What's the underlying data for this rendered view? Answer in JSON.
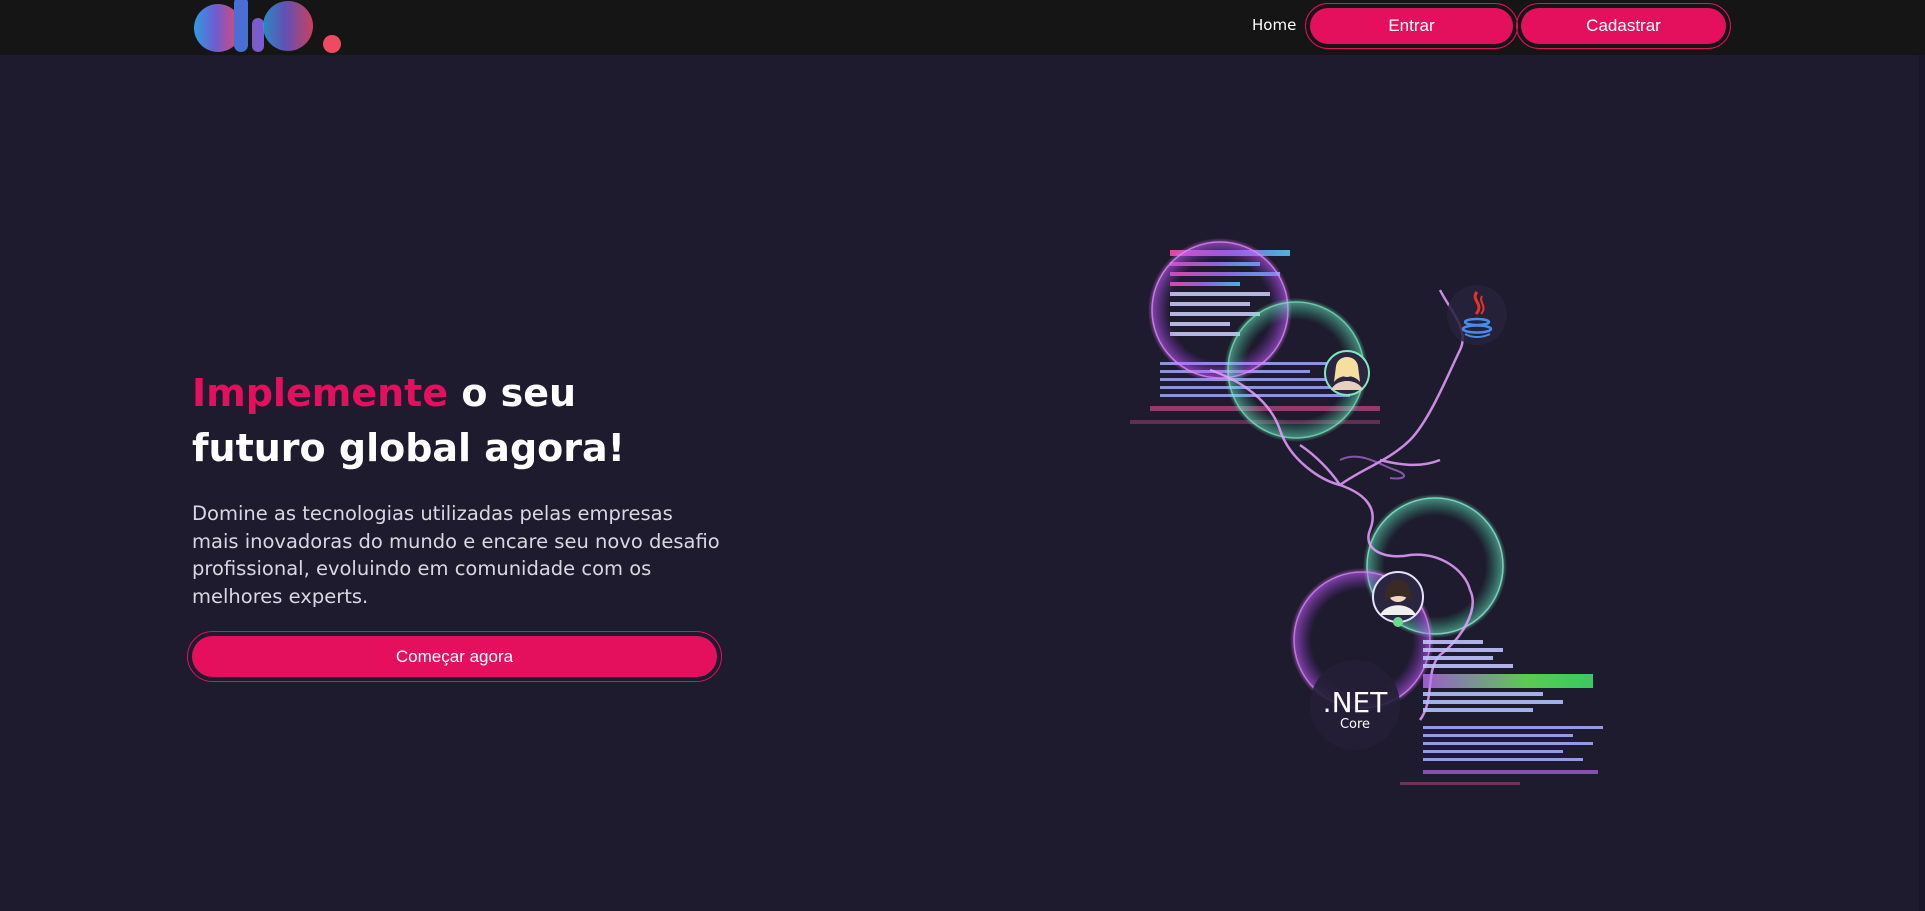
{
  "nav": {
    "home": "Home",
    "login": "Entrar",
    "signup": "Cadastrar"
  },
  "hero": {
    "title_accent": "Implemente",
    "title_rest_line1": " o seu",
    "title_line2": "futuro global agora!",
    "description": "Domine as tecnologias utilizadas pelas empresas mais inovadoras do mundo e encare seu novo desafio profissional, evoluindo em comunidade com os melhores experts.",
    "cta": "Começar agora"
  },
  "illustration": {
    "net_label": ".NET",
    "core_label": "Core"
  },
  "icons": {
    "logo": "dio-logo",
    "java": "java-icon",
    "net": "dotnet-icon"
  },
  "colors": {
    "background": "#1f1b2e",
    "topbar": "#151515",
    "accent": "#e4105d"
  }
}
